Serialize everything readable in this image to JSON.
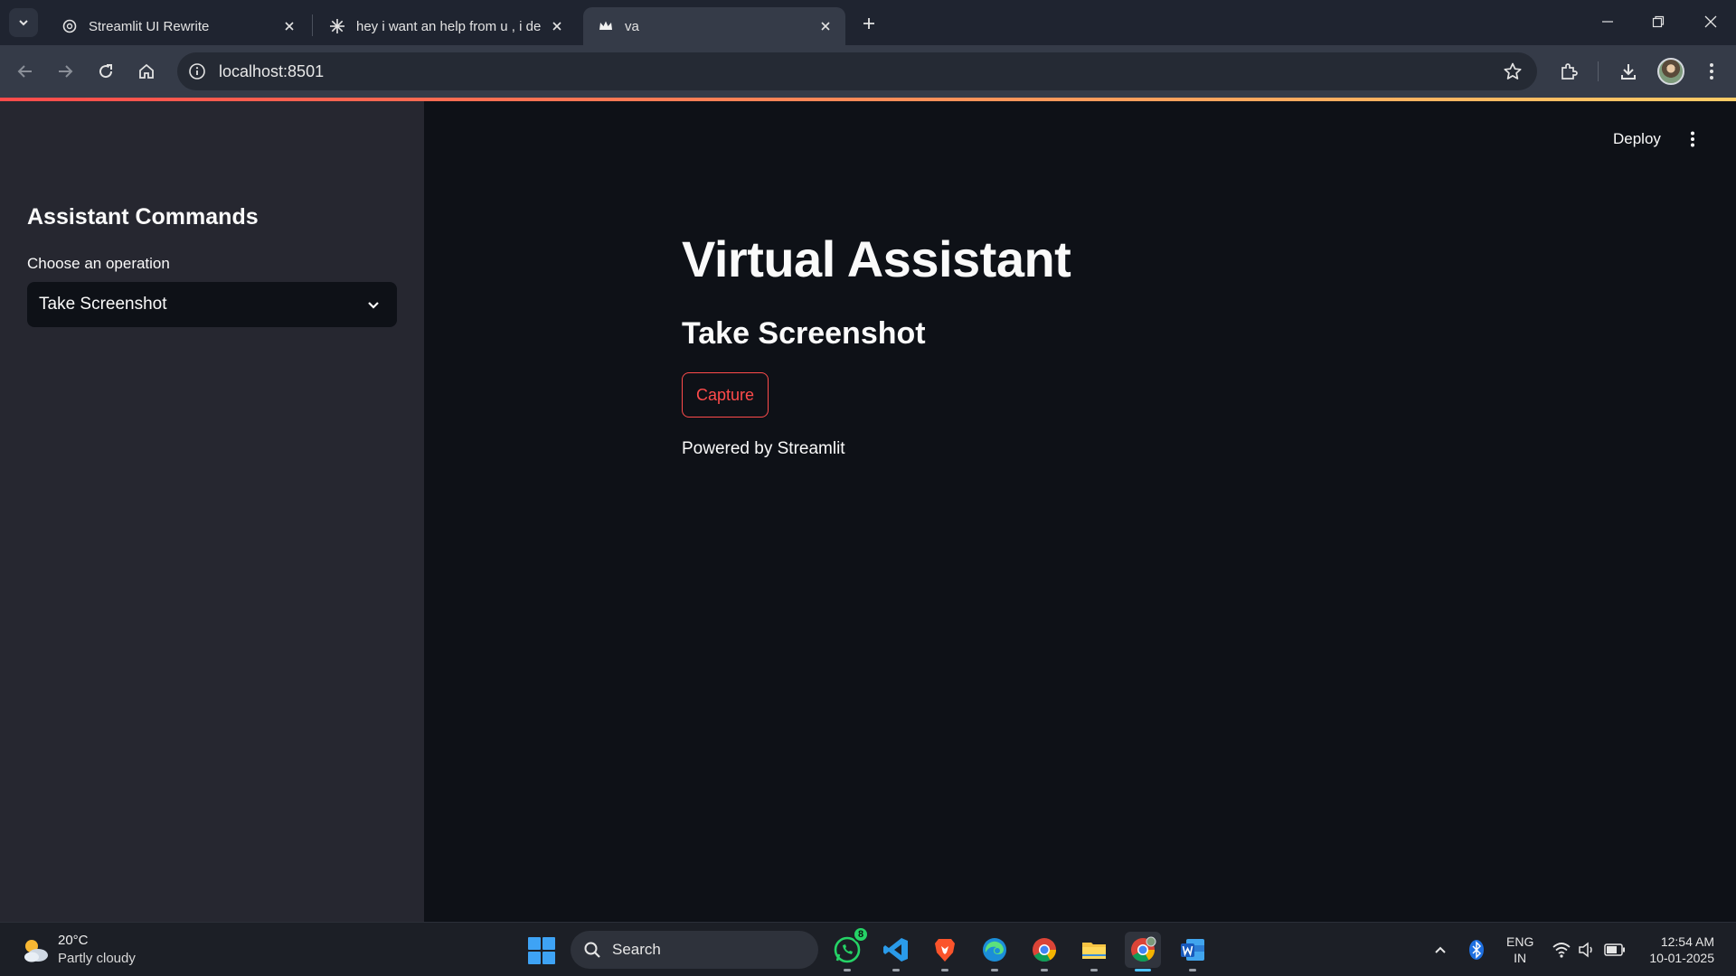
{
  "browser": {
    "tabs": [
      {
        "title": "Streamlit UI Rewrite",
        "favicon": "openai-icon",
        "active": false
      },
      {
        "title": "hey i want an help from u , i de",
        "favicon": "claude-icon",
        "active": false
      },
      {
        "title": "va",
        "favicon": "streamlit-crown-icon",
        "active": true
      }
    ],
    "url": "localhost:8501"
  },
  "app": {
    "sidebar": {
      "title": "Assistant Commands",
      "select_label": "Choose an operation",
      "select_value": "Take Screenshot"
    },
    "header": {
      "deploy_label": "Deploy"
    },
    "main": {
      "title": "Virtual Assistant",
      "subtitle": "Take Screenshot",
      "button_label": "Capture",
      "footer": "Powered by Streamlit"
    },
    "colors": {
      "accent": "#ff4b4b",
      "background": "#0e1117",
      "sidebar": "#262730"
    }
  },
  "taskbar": {
    "weather": {
      "temp": "20°C",
      "desc": "Partly cloudy"
    },
    "search_label": "Search",
    "apps": [
      "whatsapp-icon",
      "vscode-icon",
      "brave-icon",
      "edge-icon",
      "chrome-icon",
      "file-explorer-icon",
      "chrome-profile-icon",
      "word-icon"
    ],
    "whatsapp_badge": "8",
    "lang": {
      "line1": "ENG",
      "line2": "IN"
    },
    "clock": {
      "time": "12:54 AM",
      "date": "10-01-2025"
    }
  }
}
